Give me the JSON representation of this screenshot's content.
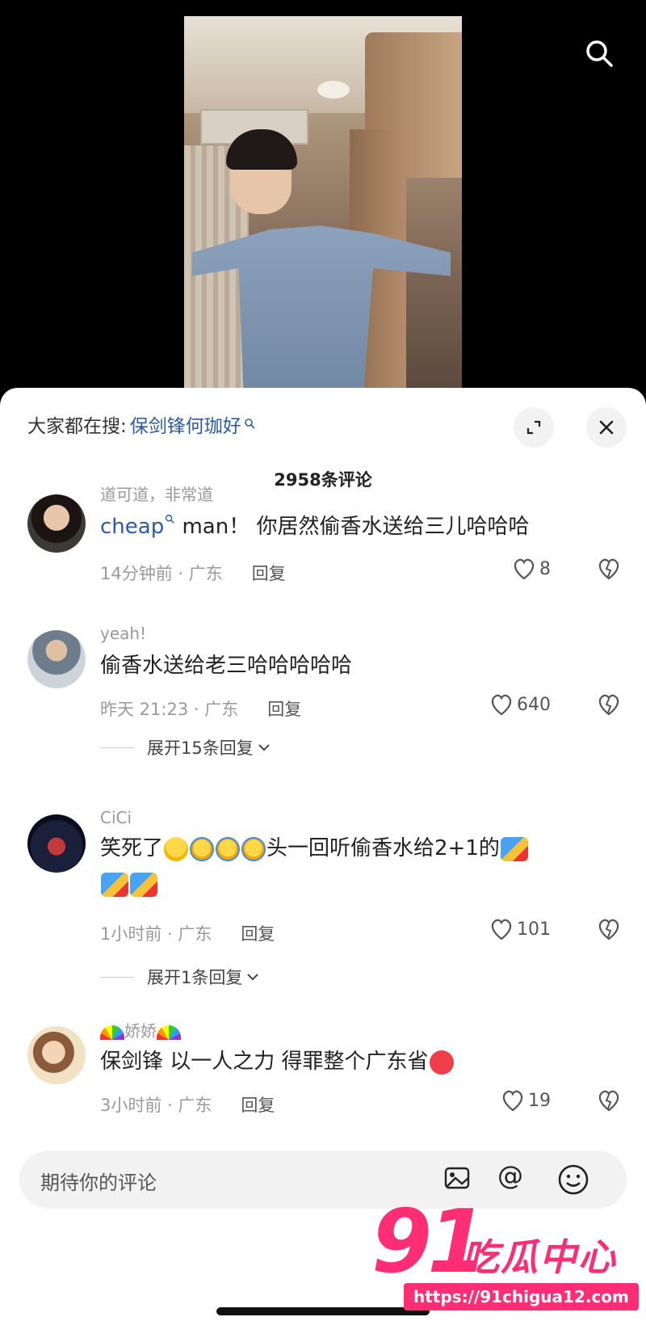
{
  "video": {
    "search_icon": "search-icon"
  },
  "sheet": {
    "trending_prefix": "大家都在搜:",
    "trending_keyword": "保剑锋何珈好",
    "expand_icon": "expand-icon",
    "close_icon": "close-icon",
    "comment_count_title": "2958条评论"
  },
  "comments": [
    {
      "nickname": "道可道，非常道",
      "mention": "cheap",
      "text": " man！ 你居然偷香水送给三儿哈哈哈",
      "time": "14分钟前 · 广东",
      "reply_label": "回复",
      "likes": "8"
    },
    {
      "nickname": "yeah!",
      "text": "偷香水送给老三哈哈哈哈哈",
      "time": "昨天 21:23 · 广东",
      "reply_label": "回复",
      "likes": "640",
      "expand_label": "展开15条回复"
    },
    {
      "nickname": "CiCi",
      "text_start": "笑死了",
      "text_end": "头一回听偷香水给2+1的",
      "time": "1小时前 · 广东",
      "reply_label": "回复",
      "likes": "101",
      "expand_label": "展开1条回复"
    },
    {
      "nickname": "娇娇",
      "text": "保剑锋  以一人之力  得罪整个广东省",
      "time": "3小时前 · 广东",
      "reply_label": "回复",
      "likes": "19"
    }
  ],
  "input_bar": {
    "placeholder": "期待你的评论",
    "at_symbol": "@"
  },
  "watermark": {
    "number": "91",
    "name": "吃瓜中心",
    "url": "https://91chigua12.com"
  },
  "colors": {
    "accent_blue": "#2b5aa6",
    "watermark_pink": "#ff2d73"
  }
}
